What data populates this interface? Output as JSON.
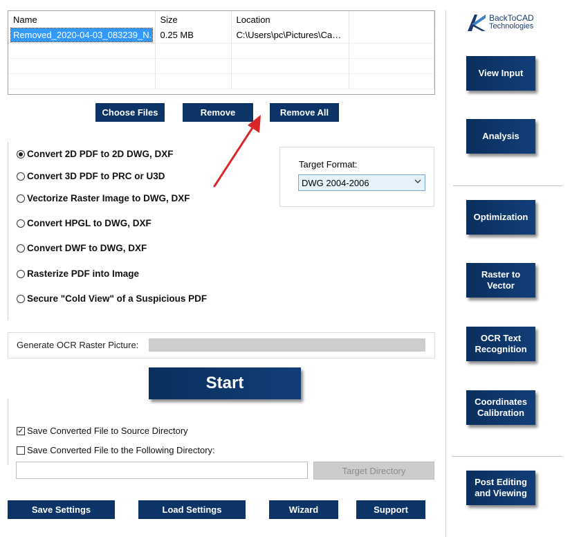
{
  "files": {
    "columns": [
      "Name",
      "Size",
      "Location"
    ],
    "rows": [
      {
        "name": "Removed_2020-04-03_083239_N...",
        "size": "0.25 MB",
        "location": "C:\\Users\\pc\\Pictures\\Cam..."
      }
    ]
  },
  "file_buttons": {
    "choose": "Choose Files",
    "remove": "Remove",
    "remove_all": "Remove All"
  },
  "conversion_options": [
    {
      "label": "Convert 2D PDF to 2D DWG, DXF",
      "selected": true
    },
    {
      "label": "Convert 3D PDF to PRC or U3D",
      "selected": false
    },
    {
      "label": "Vectorize Raster Image to DWG, DXF",
      "selected": false
    },
    {
      "label": "Convert HPGL to DWG, DXF",
      "selected": false
    },
    {
      "label": "Convert DWF to DWG, DXF",
      "selected": false
    },
    {
      "label": "Rasterize PDF into Image",
      "selected": false
    },
    {
      "label": "Secure \"Cold View\" of a Suspicious PDF",
      "selected": false
    }
  ],
  "target_format": {
    "label": "Target Format:",
    "value": "DWG 2004-2006"
  },
  "ocr": {
    "label": "Generate OCR Raster Picture:",
    "progress": 0
  },
  "start": "Start",
  "save_options": [
    {
      "label": "Save Converted File to Source Directory",
      "checked": true
    },
    {
      "label": "Save Converted File to the Following Directory:",
      "checked": false
    }
  ],
  "directory": {
    "value": "",
    "button": "Target Directory"
  },
  "bottom_buttons": {
    "save_settings": "Save Settings",
    "load_settings": "Load Settings",
    "wizard": "Wizard",
    "support": "Support"
  },
  "logo": {
    "line1": "BackToCAD",
    "line2": "Technologies"
  },
  "side_buttons": [
    {
      "name": "view-input",
      "line1": "View Input",
      "line2": ""
    },
    {
      "name": "analysis",
      "line1": "Analysis",
      "line2": ""
    },
    {
      "name": "optimization",
      "line1": "Optimization",
      "line2": ""
    },
    {
      "name": "raster-to-vector",
      "line1": "Raster to",
      "line2": "Vector"
    },
    {
      "name": "ocr-text-recognition",
      "line1": "OCR Text",
      "line2": "Recognition"
    },
    {
      "name": "coordinates-calibration",
      "line1": "Coordinates",
      "line2": "Calibration"
    },
    {
      "name": "post-editing",
      "line1": "Post Editing",
      "line2": "and Viewing"
    }
  ],
  "colors": {
    "button_navy": "#0d3466",
    "selection_blue": "#3399ff",
    "arrow_red": "#d9262b"
  }
}
